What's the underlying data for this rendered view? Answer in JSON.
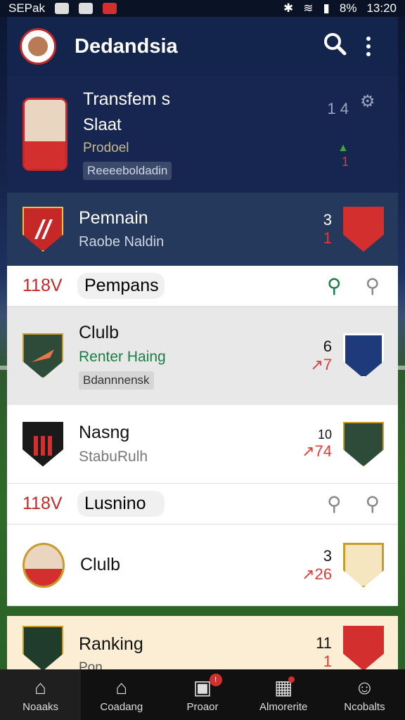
{
  "status_bar": {
    "left_text": "SEPak",
    "time": "13:20",
    "battery": "8%"
  },
  "app_bar": {
    "title": "Dedandsia"
  },
  "colors": {
    "accent_red": "#c62828",
    "dark_blue": "#14254d",
    "green": "#1b7d45"
  },
  "cards": [
    {
      "title": "Transfem s",
      "subtitle": "Slaat",
      "meta": "Prodoel",
      "chip": "Reeeeboldadin",
      "num_top": "1 4",
      "num_bottom": "1"
    },
    {
      "title": "Pemnain",
      "subtitle": "Raobe Naldin",
      "num_top": "3",
      "num_bottom": "1"
    },
    {
      "title": "Clulb",
      "subtitle": "Renter Haing",
      "chip": "Bdannnensk",
      "num_top": "6",
      "num_bottom": "7"
    },
    {
      "title": "Nasng",
      "subtitle": "StabuRulh",
      "num_top": "10",
      "num_bottom": "74"
    },
    {
      "title": "Clulb",
      "num_top": "3",
      "num_bottom": "26"
    },
    {
      "title": "Ranking",
      "subtitle": "Pon",
      "num_top": "11",
      "num_bottom": "1"
    }
  ],
  "sections": [
    {
      "number": "118V",
      "label": "Pempans"
    },
    {
      "number": "118V",
      "label": "Lusnino"
    }
  ],
  "bottom_nav": [
    {
      "label": "Noaaks",
      "icon": "home-icon"
    },
    {
      "label": "Coadang",
      "icon": "house-icon"
    },
    {
      "label": "Proaor",
      "icon": "media-icon",
      "badge": "!"
    },
    {
      "label": "Almorerite",
      "icon": "calendar-icon"
    },
    {
      "label": "Ncobalts",
      "icon": "user-icon"
    }
  ]
}
